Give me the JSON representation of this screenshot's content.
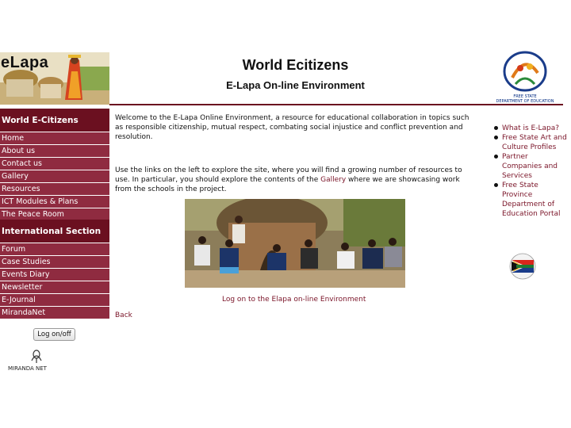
{
  "header": {
    "logo_text": "eLapa",
    "title": "World Ecitizens",
    "subtitle": "E-Lapa On-line Environment",
    "dept_logo_text_line1": "FREE STATE",
    "dept_logo_text_line2": "DEPARTMENT OF EDUCATION"
  },
  "sidebar": {
    "section1_heading": "World E-Citizens",
    "section1_items": [
      {
        "label": "Home"
      },
      {
        "label": "About us"
      },
      {
        "label": "Contact us"
      },
      {
        "label": "Gallery"
      },
      {
        "label": "Resources"
      },
      {
        "label": "ICT Modules & Plans"
      },
      {
        "label": "The Peace Room"
      }
    ],
    "section2_heading": "International Section",
    "section2_items": [
      {
        "label": "Forum"
      },
      {
        "label": "Case Studies"
      },
      {
        "label": "Events Diary"
      },
      {
        "label": "Newsletter"
      },
      {
        "label": "E-Journal"
      },
      {
        "label": "MirandaNet"
      }
    ],
    "logon_button": "Log on/off",
    "mirandanet_logo_text": "MIRANDA NET"
  },
  "main": {
    "intro": "Welcome to the E-Lapa Online Environment, a resource for educational collaboration in topics such as responsible citizenship, mutual respect, combating social injustice and conflict prevention and resolution.",
    "explore_before": "Use the links on the left to explore the site, where you will find a growing number of resources to use. In particular, you should explore the contents of the ",
    "explore_link": "Gallery",
    "explore_after": " where we are showcasing work from the schools in the project.",
    "photo_caption": "Log on to the Elapa on-line Environment",
    "back_link": "Back"
  },
  "right_links": [
    {
      "label": "What is E-Lapa?"
    },
    {
      "label": "Free State Art and Culture Profiles"
    },
    {
      "label": "Partner Companies and Services"
    },
    {
      "label": "Free State Province Department of Education Portal"
    }
  ],
  "colors": {
    "nav_dark": "#6b1020",
    "nav_item": "#8f2b40",
    "link": "#7a1428"
  }
}
